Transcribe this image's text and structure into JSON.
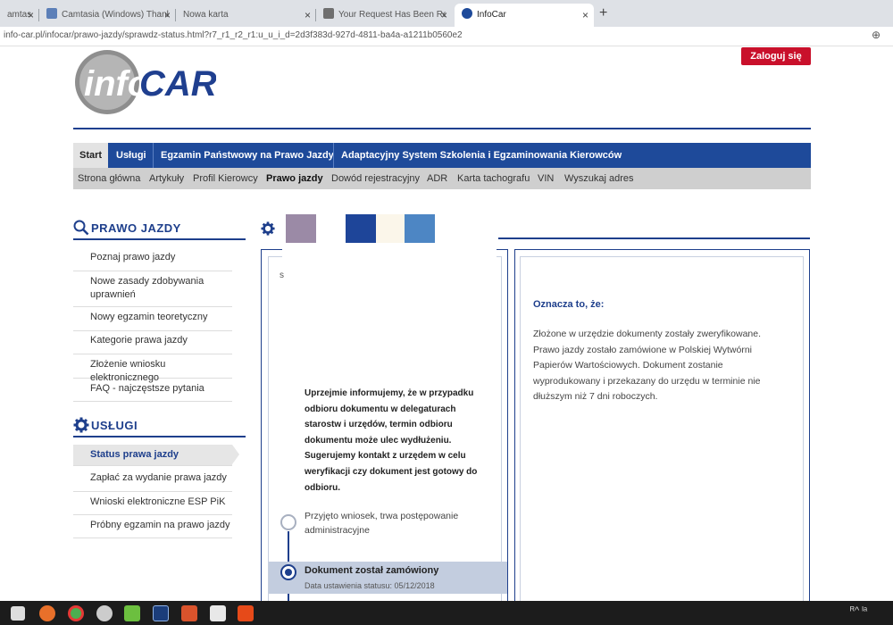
{
  "browser": {
    "tabs": [
      {
        "title": "amtas",
        "active": false
      },
      {
        "title": "Camtasia (Windows) Thank You",
        "active": false
      },
      {
        "title": "Nowa karta",
        "active": false
      },
      {
        "title": "Your Request Has Been Received",
        "active": false
      },
      {
        "title": "InfoCar",
        "active": true
      }
    ],
    "new_tab": "+",
    "close": "×",
    "url": "info-car.pl/infocar/prawo-jazdy/sprawdz-status.html?r7_r1_r2_r1:u_u_i_d=2d3f383d-927d-4811-ba4a-a1211b0560e2",
    "zoom_icon": "⊕"
  },
  "header": {
    "logo_info": "info",
    "logo_car": "CAR",
    "login_label": "Zaloguj się"
  },
  "nav": {
    "items": [
      "Start",
      "Usługi",
      "Egzamin Państwowy na Prawo Jazdy",
      "Adaptacyjny System Szkolenia i Egzaminowania Kierowców"
    ]
  },
  "subnav": {
    "items": [
      "Strona główna",
      "Artykuły",
      "Profil Kierowcy",
      "Prawo jazdy",
      "Dowód rejestracyjny",
      "ADR",
      "Karta tachografu",
      "VIN",
      "Wyszukaj adres"
    ]
  },
  "sidebar": {
    "section1_title": "PRAWO JAZDY",
    "section1_items": [
      "Poznaj prawo jazdy",
      "Nowe zasady zdobywania uprawnień",
      "Nowy egzamin teoretyczny",
      "Kategorie prawa jazdy",
      "Złożenie wniosku elektronicznego",
      "FAQ - najczęstsze pytania"
    ],
    "section2_title": "USŁUGI",
    "section2_items": [
      "Status prawa jazdy",
      "Zapłać za wydanie prawa jazdy",
      "Wnioski elektroniczne ESP PiK",
      "Próbny egzamin na prawo jazdy"
    ]
  },
  "main": {
    "small_mark": "s",
    "notice": "Uprzejmie informujemy, że w przypadku odbioru dokumentu w delegaturach starostw i urzędów, termin odbioru dokumentu może ulec wydłużeniu. Sugerujemy kontakt z urzędem w celu weryfikacji czy dokument jest gotowy do odbioru.",
    "step1": "Przyjęto wniosek, trwa postępowanie administracyjne",
    "step2_title": "Dokument został zamówiony",
    "step2_date": "Data ustawienia statusu: 05/12/2018",
    "meaning_title": "Oznacza to, że:",
    "meaning_text": "Złożone w urzędzie dokumenty zostały zweryfikowane. Prawo jazdy zostało zamówione w Polskiej Wytwórni Papierów Wartościowych. Dokument zostanie wyprodukowany i przekazany do urzędu w terminie nie dłuższym niż 7 dni roboczych."
  },
  "taskbar": {
    "tray_text": "ᴿ^ ᴵᵃ"
  },
  "colors": {
    "brand_blue": "#1e4a9a",
    "login_red": "#c9102b",
    "swatches": [
      "#9b8aa6",
      "#1e4599",
      "#fbf6ea",
      "#4d86c4"
    ]
  }
}
